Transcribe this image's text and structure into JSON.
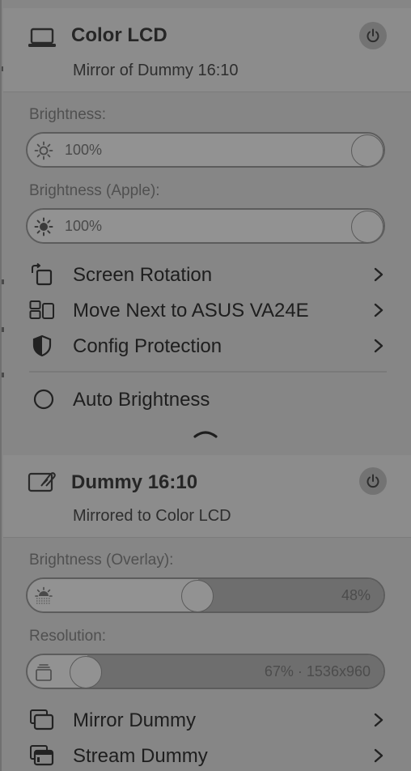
{
  "displays": [
    {
      "title": "Color LCD",
      "subtitle": "Mirror of Dummy 16:10",
      "device_icon": "laptop-icon",
      "brightness_label": "Brightness:",
      "brightness_value": "100%",
      "brightness_level": 1.0,
      "apple_brightness_label": "Brightness (Apple):",
      "apple_brightness_value": "100%",
      "apple_brightness_level": 1.0,
      "menu_items": [
        {
          "label": "Screen Rotation",
          "icon": "rotate-icon"
        },
        {
          "label": "Move Next to ASUS VA24E",
          "icon": "arrange-displays-icon"
        },
        {
          "label": "Config Protection",
          "icon": "shield-icon"
        }
      ],
      "auto_brightness_label": "Auto Brightness"
    },
    {
      "title": "Dummy 16:10",
      "subtitle": "Mirrored to Color LCD",
      "device_icon": "dummy-display-icon",
      "overlay_brightness_label": "Brightness (Overlay):",
      "overlay_brightness_value": "48%",
      "overlay_brightness_level": 0.48,
      "resolution_label": "Resolution:",
      "resolution_value": "67% · 1536x960",
      "resolution_level": 0.0,
      "menu_items": [
        {
          "label": "Mirror Dummy",
          "icon": "mirror-icon"
        },
        {
          "label": "Stream Dummy",
          "icon": "stream-icon"
        }
      ]
    }
  ],
  "colors": {
    "panel": "#868686",
    "header": "#8c8c8c",
    "text_primary": "#1e1e1e",
    "text_secondary": "#505050"
  }
}
